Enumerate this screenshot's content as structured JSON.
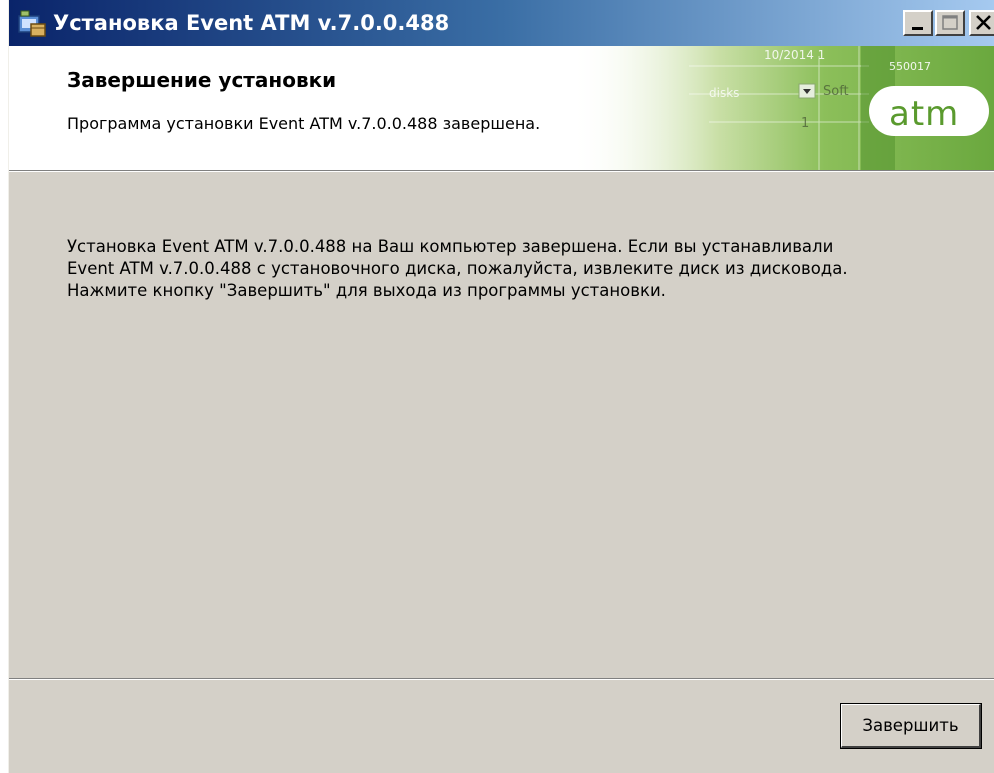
{
  "window": {
    "title": "Установка Event ATM v.7.0.0.488"
  },
  "title_bar": {
    "icons": [
      "installer-app-icon",
      "minimize-icon",
      "maximize-icon",
      "close-icon"
    ]
  },
  "header": {
    "title": "Завершение установки",
    "subtitle": "Программа установки Event ATM v.7.0.0.488 завершена.",
    "logo_text": "atm",
    "background_snippets": [
      "10/2014 1",
      "550017",
      "Soft",
      "disks",
      "1"
    ]
  },
  "body": {
    "message": "Установка Event ATM v.7.0.0.488 на Ваш компьютер завершена. Если вы устанавливали Event ATM v.7.0.0.488 с установочного диска, пожалуйста, извлеките диск из дисковода. Нажмите кнопку \"Завершить\" для выхода из программы установки."
  },
  "footer": {
    "finish_label": "Завершить"
  },
  "colors": {
    "titlebar_start": "#0a246a",
    "titlebar_end": "#a6caf0",
    "dialog_background": "#d4d0c8",
    "banner_accent": "#7ab648"
  }
}
